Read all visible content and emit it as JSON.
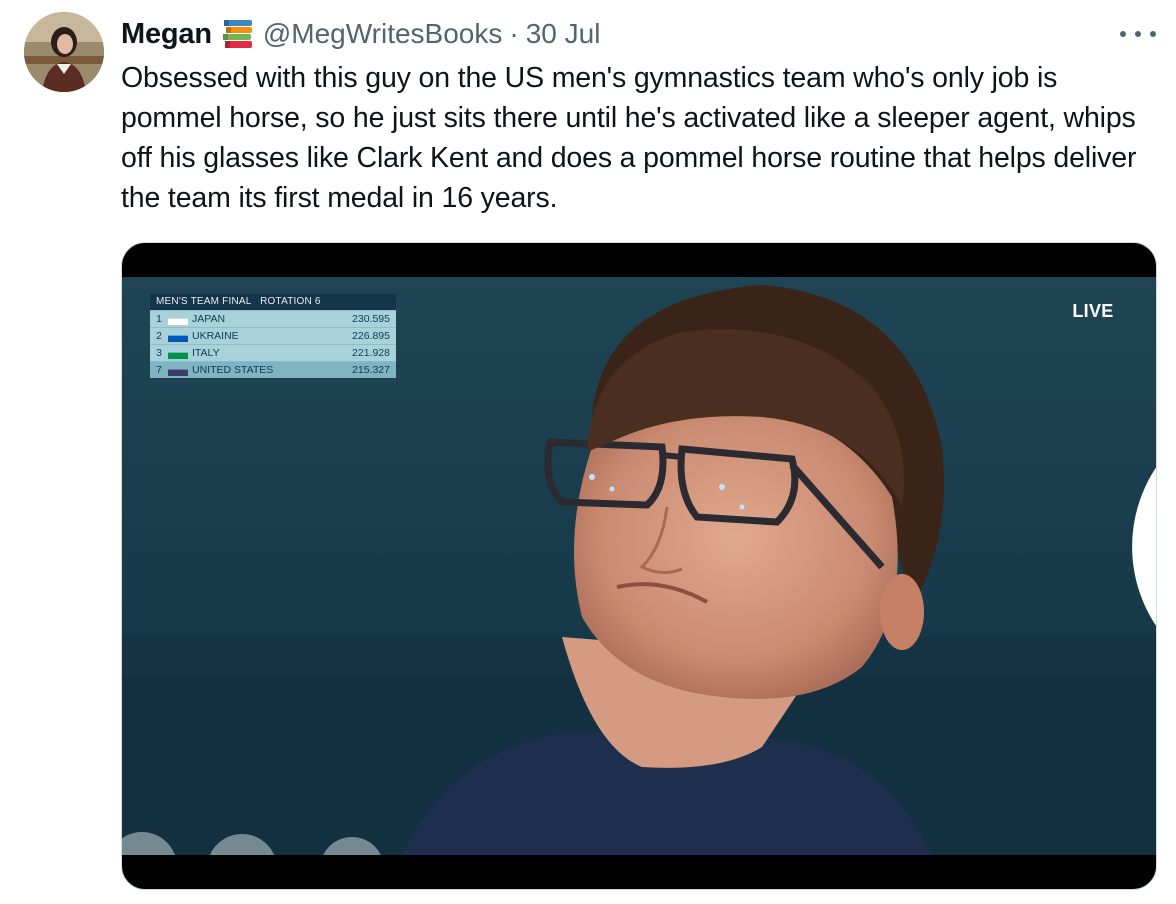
{
  "tweet": {
    "author_name": "Megan",
    "handle": "@MegWritesBooks",
    "separator": "·",
    "date": "30 Jul",
    "text": "Obsessed with this guy on the US men's gymnastics team who's only job is pommel horse, so he just sits there until he's activated like a sleeper agent, whips off his glasses like Clark Kent and does a pommel horse routine that helps deliver the team its first medal in 16 years."
  },
  "icons": {
    "name_emoji": "books-icon",
    "more": "more-options-icon",
    "broadcaster": "nbc-peacock-icon",
    "olympic": "olympic-rings-icon"
  },
  "media": {
    "scoreboard": {
      "title": "MEN'S TEAM FINAL",
      "subtitle": "ROTATION 6",
      "rows": [
        {
          "rank": "1",
          "team": "JAPAN",
          "score": "230.595",
          "flag": "japan"
        },
        {
          "rank": "2",
          "team": "UKRAINE",
          "score": "226.895",
          "flag": "ukraine"
        },
        {
          "rank": "3",
          "team": "ITALY",
          "score": "221.928",
          "flag": "italy"
        },
        {
          "rank": "7",
          "team": "UNITED STATES",
          "score": "215.327",
          "flag": "usa"
        }
      ]
    },
    "live_label": "LIVE"
  },
  "colors": {
    "text_primary": "#0f1419",
    "text_secondary": "#536471",
    "media_border": "#cfd9de",
    "scoreboard_bg": "#a9d1da",
    "scoreboard_header": "#14344a"
  }
}
